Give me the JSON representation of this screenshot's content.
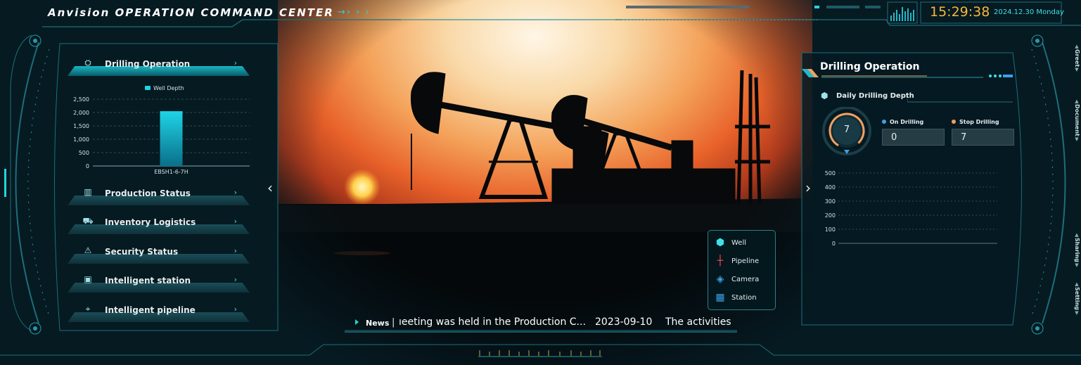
{
  "header": {
    "title": "Anvision OPERATION COMMAND CENTER",
    "arrows": "→›  ›  ›",
    "time": "15:29:38",
    "date": "2024.12.30 Monday"
  },
  "left_panel": {
    "menu": [
      {
        "label": "Drilling Operation",
        "icon": "drill-icon",
        "active": true
      },
      {
        "label": "Production Status",
        "icon": "factory-icon",
        "active": false
      },
      {
        "label": "Inventory Logistics",
        "icon": "truck-icon",
        "active": false
      },
      {
        "label": "Security Status",
        "icon": "alarm-icon",
        "active": false
      },
      {
        "label": "Intelligent station",
        "icon": "station-icon",
        "active": false
      },
      {
        "label": "Intelligent pipeline",
        "icon": "pin-icon",
        "active": false
      }
    ],
    "chevron": "›"
  },
  "chart_data": {
    "type": "bar",
    "categories": [
      "EBSH1-6-7H"
    ],
    "series": [
      {
        "name": "Well Depth",
        "values": [
          2050
        ]
      }
    ],
    "ylim": [
      0,
      2500
    ],
    "yticks": [
      "2,500",
      "2,000",
      "1,500",
      "1,000",
      "500",
      "0"
    ],
    "grid": true,
    "legend": "top-center",
    "colors": {
      "bar_top": "#1fd4e6",
      "bar_bottom": "#0a6f8a"
    }
  },
  "right_panel": {
    "title": "Drilling Operation",
    "subtitle": "Daily Drilling Depth",
    "gauge_value": "7",
    "on_drilling_label": "On Drilling",
    "on_drilling_value": "0",
    "stop_drilling_label": "Stop Drilling",
    "stop_drilling_value": "7",
    "yticks": [
      "500",
      "400",
      "300",
      "200",
      "100",
      "0"
    ]
  },
  "legend": {
    "items": [
      {
        "label": "Well",
        "icon": "well-icon"
      },
      {
        "label": "Pipeline",
        "icon": "pipeline-icon"
      },
      {
        "label": "Camera",
        "icon": "camera-icon"
      },
      {
        "label": "Station",
        "icon": "station-icon"
      }
    ]
  },
  "news": {
    "label": "News",
    "text": "ıeeting was held in the Production C...",
    "date": "2023-09-10",
    "text2": "The activities"
  },
  "side_tabs": [
    "Greet",
    "Document",
    "Sharing",
    "Setting"
  ],
  "nav": {
    "left_arrow": "‹",
    "right_arrow": "›"
  },
  "colors": {
    "accent": "#3fe0e8",
    "clock": "#f6b63c",
    "panel_bg": "#061a22",
    "gauge": "#f0a060"
  }
}
